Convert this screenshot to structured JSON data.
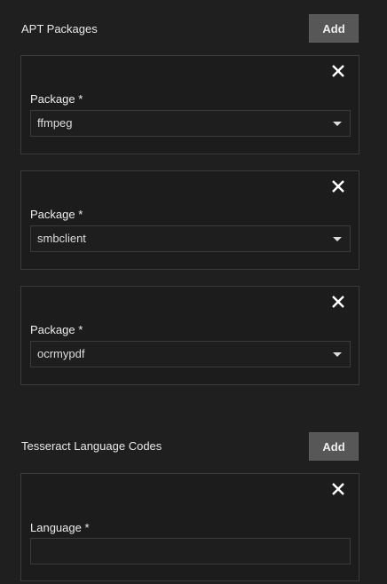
{
  "apt": {
    "title": "APT Packages",
    "add_label": "Add",
    "items": [
      {
        "label": "Package",
        "required": "*",
        "value": "ffmpeg"
      },
      {
        "label": "Package",
        "required": "*",
        "value": "smbclient"
      },
      {
        "label": "Package",
        "required": "*",
        "value": "ocrmypdf"
      }
    ]
  },
  "tess": {
    "title": "Tesseract Language Codes",
    "add_label": "Add",
    "items": [
      {
        "label": "Language",
        "required": "*",
        "value": ""
      }
    ]
  }
}
